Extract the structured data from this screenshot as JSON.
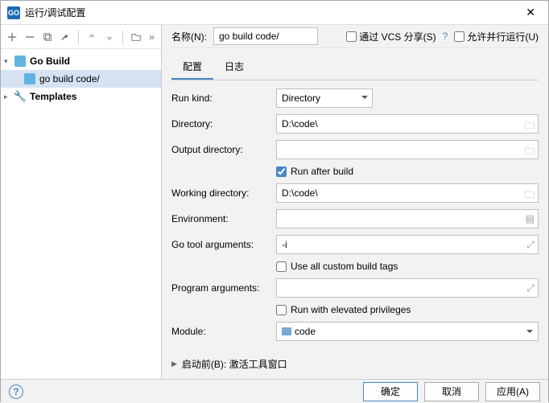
{
  "window": {
    "title": "运行/调试配置"
  },
  "tree": {
    "gobuild": "Go Build",
    "gobuild_child": "go build code/",
    "templates": "Templates"
  },
  "header": {
    "name_label": "名称(N):",
    "name_value": "go build code/",
    "share_vcs": "通过 VCS 分享(S)",
    "allow_parallel": "允许并行运行(U)"
  },
  "tabs": {
    "config": "配置",
    "log": "日志"
  },
  "form": {
    "run_kind": "Run kind:",
    "run_kind_value": "Directory",
    "directory": "Directory:",
    "directory_value": "D:\\code\\",
    "output_dir": "Output directory:",
    "output_dir_value": "",
    "run_after_build": "Run after build",
    "working_dir": "Working directory:",
    "working_dir_value": "D:\\code\\",
    "environment": "Environment:",
    "environment_value": "",
    "go_tool_args": "Go tool arguments:",
    "go_tool_args_value": "-i",
    "use_all_tags": "Use all custom build tags",
    "program_args": "Program arguments:",
    "program_args_value": "",
    "run_elevated": "Run with elevated privileges",
    "module": "Module:",
    "module_value": "code"
  },
  "collapse": {
    "before_launch": "启动前(B): 激活工具窗口"
  },
  "footer": {
    "ok": "确定",
    "cancel": "取消",
    "apply": "应用(A)"
  }
}
